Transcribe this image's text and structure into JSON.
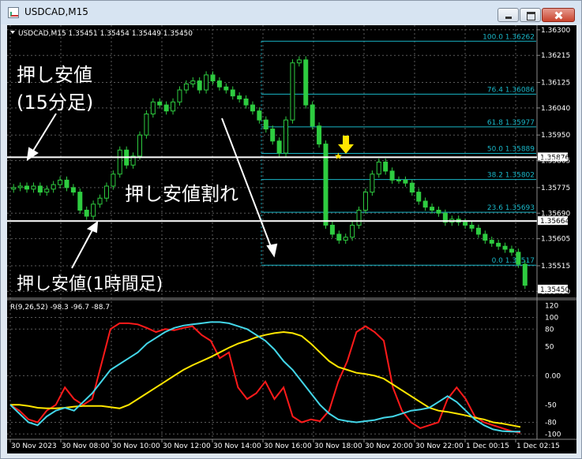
{
  "window": {
    "title": "USDCAD,M15"
  },
  "colors": {
    "background": "#000000",
    "grid": "#5a5a5a",
    "candle": "#2ecc40",
    "fib": "#19b6c7",
    "support": "#ffffff",
    "arrow": "#ffe600",
    "wpr": "#ff1a1a",
    "slow": "#ffe600",
    "fast": "#43d6e8"
  },
  "chart_data": [
    {
      "type": "candlestick",
      "header": "USDCAD,M15  1.35451 1.35454 1.35449 1.35450",
      "current_price": "1.35450",
      "price_axis": [
        "1.36300",
        "1.36215",
        "1.36125",
        "1.36040",
        "1.35950",
        "1.35865",
        "1.35775",
        "1.35690",
        "1.35605",
        "1.35515",
        "1.35430"
      ],
      "ylim": [
        1.3541,
        1.3631
      ],
      "levels": [
        {
          "name": "support-15m",
          "price": 1.35876,
          "label": "1.35876"
        },
        {
          "name": "support-1h",
          "price": 1.35664,
          "label": "1.35664"
        }
      ],
      "fib_levels": [
        {
          "label": "100.0  1.36262",
          "price": 1.36262
        },
        {
          "label": "76.4  1.36086",
          "price": 1.36086
        },
        {
          "label": "61.8  1.35977",
          "price": 1.35977
        },
        {
          "label": "50.0  1.35889",
          "price": 1.35889
        },
        {
          "label": "38.2  1.35802",
          "price": 1.35802
        },
        {
          "label": "23.6  1.35693",
          "price": 1.35693
        },
        {
          "label": "0.0  1.35517",
          "price": 1.35517
        }
      ],
      "closes": [
        1.35775,
        1.3578,
        1.3577,
        1.3578,
        1.3576,
        1.3577,
        1.35785,
        1.358,
        1.35775,
        1.3576,
        1.357,
        1.3568,
        1.3572,
        1.3574,
        1.3578,
        1.3582,
        1.359,
        1.3585,
        1.3588,
        1.3595,
        1.3602,
        1.3606,
        1.3605,
        1.3603,
        1.3606,
        1.361,
        1.3612,
        1.3613,
        1.361,
        1.3615,
        1.3613,
        1.3611,
        1.361,
        1.3608,
        1.3607,
        1.3605,
        1.3603,
        1.36,
        1.3597,
        1.3593,
        1.3589,
        1.36,
        1.3619,
        1.362,
        1.3605,
        1.3598,
        1.3592,
        1.3565,
        1.3562,
        1.356,
        1.3561,
        1.3565,
        1.357,
        1.3576,
        1.3582,
        1.3586,
        1.3583,
        1.358,
        1.358,
        1.3579,
        1.3576,
        1.3573,
        1.3571,
        1.357,
        1.3569,
        1.3566,
        1.3567,
        1.3566,
        1.3565,
        1.3564,
        1.3562,
        1.356,
        1.3559,
        1.3558,
        1.3557,
        1.3556,
        1.3552,
        1.3545
      ]
    },
    {
      "type": "line",
      "header": "R(9,26,52) -98.3 -96.7 -88.7",
      "y_axis": [
        "120",
        "100",
        "80",
        "50",
        "0.00",
        "-50",
        "-80",
        "-100"
      ],
      "ylim": [
        -105,
        125
      ],
      "series": [
        {
          "color": "#ff1a1a",
          "values": [
            -50,
            -60,
            -75,
            -80,
            -60,
            -50,
            -20,
            -40,
            -50,
            -40,
            20,
            80,
            90,
            90,
            88,
            82,
            75,
            80,
            78,
            82,
            85,
            70,
            60,
            30,
            40,
            -20,
            -40,
            -30,
            -10,
            -40,
            -20,
            -70,
            -80,
            -75,
            -78,
            -60,
            -10,
            25,
            75,
            85,
            75,
            60,
            -20,
            -60,
            -80,
            -90,
            -85,
            -80,
            -40,
            -20,
            -40,
            -70,
            -80,
            -85,
            -90,
            -95,
            -98
          ]
        },
        {
          "color": "#ffe600",
          "values": [
            -50,
            -50,
            -52,
            -55,
            -56,
            -56,
            -55,
            -53,
            -52,
            -52,
            -52,
            -54,
            -56,
            -50,
            -40,
            -30,
            -20,
            -10,
            0,
            10,
            18,
            25,
            32,
            40,
            48,
            55,
            60,
            66,
            70,
            73,
            75,
            73,
            68,
            55,
            40,
            25,
            15,
            10,
            5,
            3,
            0,
            -5,
            -15,
            -25,
            -35,
            -45,
            -55,
            -60,
            -62,
            -65,
            -68,
            -72,
            -75,
            -80,
            -82,
            -85,
            -88
          ]
        },
        {
          "color": "#43d6e8",
          "values": [
            -50,
            -65,
            -80,
            -85,
            -70,
            -60,
            -55,
            -60,
            -45,
            -30,
            -10,
            10,
            20,
            30,
            40,
            55,
            65,
            75,
            82,
            86,
            88,
            90,
            92,
            92,
            90,
            85,
            80,
            70,
            60,
            45,
            25,
            10,
            -10,
            -30,
            -50,
            -65,
            -75,
            -78,
            -80,
            -78,
            -76,
            -72,
            -70,
            -65,
            -60,
            -58,
            -55,
            -45,
            -35,
            -45,
            -60,
            -75,
            -85,
            -92,
            -95,
            -96,
            -96
          ]
        }
      ]
    }
  ],
  "time_axis": [
    "30 Nov 2023",
    "30 Nov 08:00",
    "30 Nov 10:00",
    "30 Nov 12:00",
    "30 Nov 14:00",
    "30 Nov 16:00",
    "30 Nov 18:00",
    "30 Nov 20:00",
    "30 Nov 22:00",
    "1 Dec 00:15",
    "1 Dec 02:15"
  ],
  "annotations": {
    "support_15m_line1": "押し安値",
    "support_15m_line2": "(15分足)",
    "support_1h": "押し安値(1時間足)",
    "break": "押し安値割れ"
  }
}
